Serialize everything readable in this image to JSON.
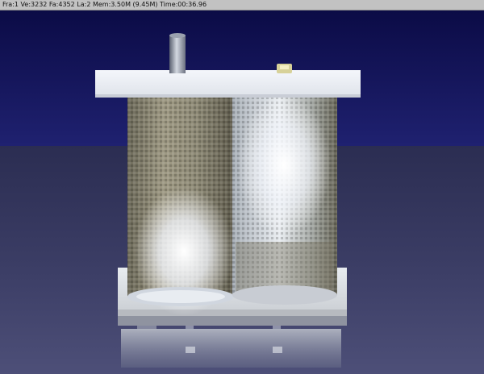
{
  "window": {
    "status_text": "Fra:1  Ve:3232 Fa:4352 La:2 Mem:3.50M (9.45M) Time:00:36.96"
  },
  "render": {
    "scene": "cylinder-module-render",
    "colors": {
      "sky_top": "#0d0d4a",
      "sky_bottom": "#1d1e6e",
      "floor_far": "#2e3154",
      "floor_near": "#4a4c73",
      "plate": "#e9edf3",
      "metal_dark": "#7a7a6a",
      "metal_light": "#c9ced4"
    }
  }
}
